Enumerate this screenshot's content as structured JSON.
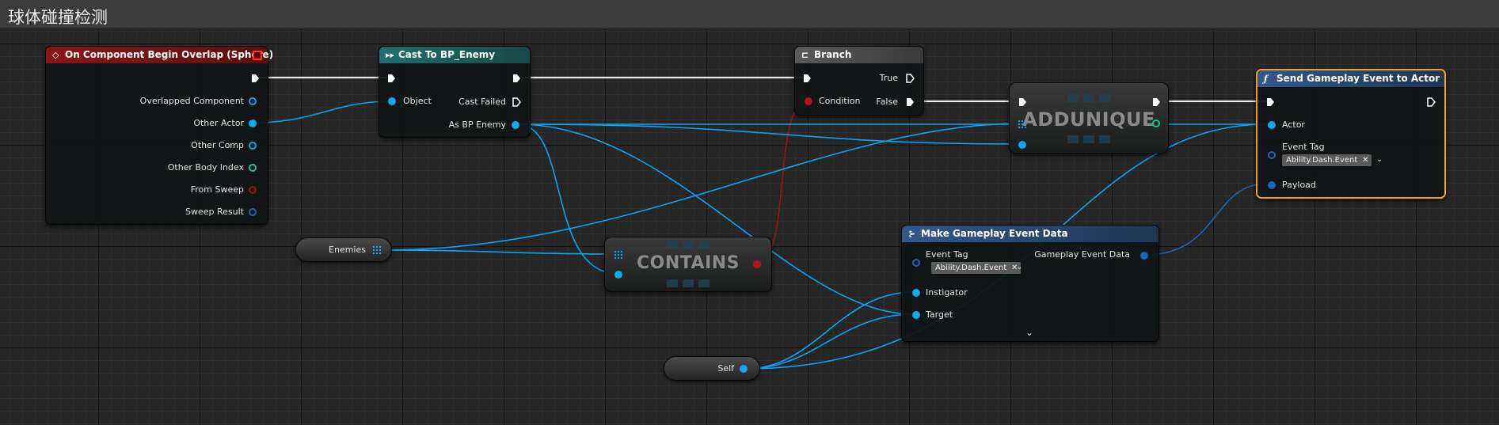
{
  "window": {
    "title": "球体碰撞检测"
  },
  "nodes": {
    "overlap": {
      "title": "On Component Begin Overlap (Sphere)",
      "pins": [
        "Overlapped Component",
        "Other Actor",
        "Other Comp",
        "Other Body Index",
        "From Sweep",
        "Sweep Result"
      ],
      "header_color": "#7a1313"
    },
    "cast": {
      "title": "Cast To BP_Enemy",
      "object_label": "Object",
      "cast_failed_label": "Cast Failed",
      "as_label": "As BP Enemy",
      "header_color": "#1e5e5e"
    },
    "branch": {
      "title": "Branch",
      "true_label": "True",
      "false_label": "False",
      "condition_label": "Condition",
      "header_color": "#4a4a4a"
    },
    "addunique": {
      "title": "ADDUNIQUE"
    },
    "contains": {
      "title": "CONTAINS"
    },
    "send_event": {
      "title": "Send Gameplay Event to Actor",
      "actor_label": "Actor",
      "event_tag_label": "Event Tag",
      "tag_value": "Ability.Dash.Event",
      "payload_label": "Payload",
      "header_color": "#2b4b70",
      "border_color": "#f0a020"
    },
    "make_event": {
      "title": "Make Gameplay Event Data",
      "event_tag_label": "Event Tag",
      "tag_value": "Ability.Dash.Event",
      "output_label": "Gameplay Event Data",
      "instigator_label": "Instigator",
      "target_label": "Target",
      "header_color": "#2b4b70"
    },
    "enemies_var": {
      "label": "Enemies"
    },
    "self_var": {
      "label": "Self"
    }
  },
  "colors": {
    "exec_wire": "#e8e8e8",
    "object_wire": "#0ba4f2",
    "bool_wire": "#9e1212",
    "struct_wire": "#1a64c0"
  },
  "icons": {
    "event": "event-diamond-icon",
    "cast": "cast-arrows-icon",
    "branch": "branch-icon",
    "function": "function-icon",
    "make_struct": "make-struct-icon"
  }
}
